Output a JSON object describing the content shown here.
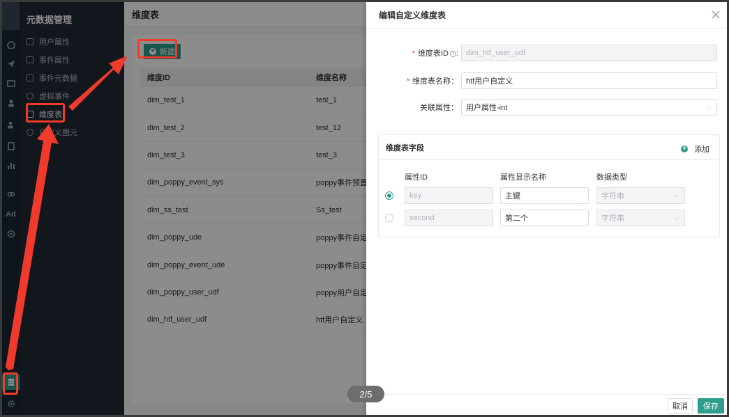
{
  "sidebar": {
    "title": "元数据管理",
    "items": [
      {
        "label": "用户属性"
      },
      {
        "label": "事件属性"
      },
      {
        "label": "事件元数据"
      },
      {
        "label": "虚拟事件"
      },
      {
        "label": "维度表"
      },
      {
        "label": "自定义图元"
      }
    ],
    "active_index": 4
  },
  "rail": {
    "ad_label": "Ad"
  },
  "main": {
    "title": "维度表",
    "new_button": "新建",
    "columns": [
      "维度ID",
      "维度名称"
    ],
    "rows": [
      {
        "id": "dim_test_1",
        "name": "test_1"
      },
      {
        "id": "dim_test_2",
        "name": "test_12"
      },
      {
        "id": "dim_test_3",
        "name": "test_3"
      },
      {
        "id": "dim_poppy_event_sys",
        "name": "poppy事件预置"
      },
      {
        "id": "dim_ss_test",
        "name": "Ss_test"
      },
      {
        "id": "dim_poppy_ude",
        "name": "poppy事件自定"
      },
      {
        "id": "dim_poppy_event_ude",
        "name": "poppy事件自定"
      },
      {
        "id": "dim_poppy_user_udf",
        "name": "poppy用户自定"
      },
      {
        "id": "dim_htf_user_udf",
        "name": "htf用户自定义"
      }
    ]
  },
  "drawer": {
    "title": "编辑自定义维度表",
    "id_label": "维度表ID",
    "id_value": "dim_htf_user_udf",
    "name_label": "维度表名称：",
    "name_value": "htf用户自定义",
    "attr_label": "关联属性：",
    "attr_value": "用户属性-int",
    "fields_title": "维度表字段",
    "add_label": "添加",
    "field_columns": [
      "属性ID",
      "属性显示名称",
      "数据类型"
    ],
    "fields": [
      {
        "id": "key",
        "display": "主键",
        "type": "字符串",
        "selected": true
      },
      {
        "id": "second",
        "display": "第二个",
        "type": "字符串",
        "selected": false
      }
    ],
    "cancel": "取消",
    "save": "保存"
  },
  "pager": {
    "text": "2/5"
  },
  "colors": {
    "accent": "#2f9e8f",
    "highlight": "#f03a2b",
    "sidebar_bg": "#222b38"
  }
}
